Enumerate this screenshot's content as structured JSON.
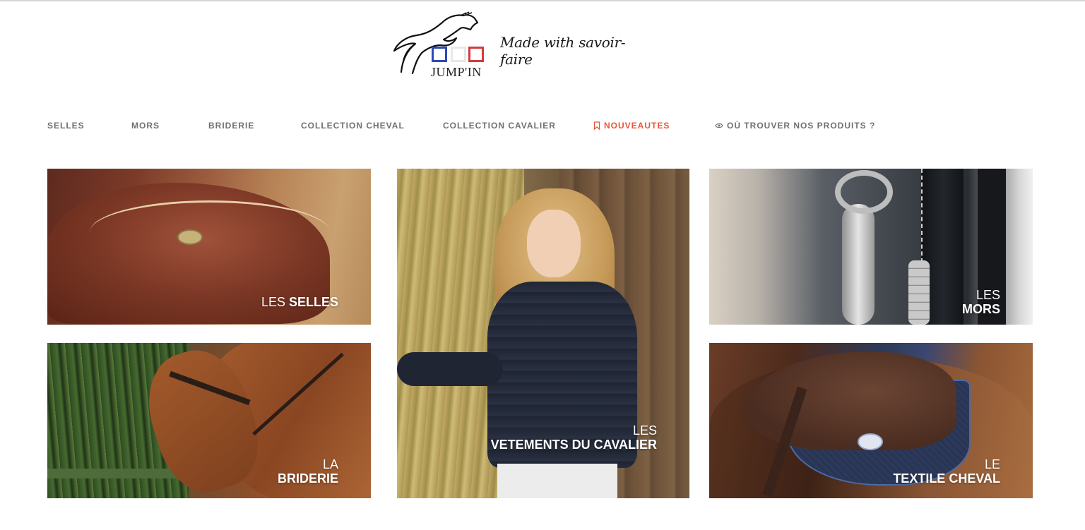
{
  "logo": {
    "brand": "JUMP'IN",
    "tagline": "Made with savoir-faire",
    "colors": {
      "blue": "#2f49b5",
      "white": "#e8e8e8",
      "red": "#d63a3a"
    }
  },
  "nav": {
    "items": [
      {
        "label": "SELLES"
      },
      {
        "label": "MORS"
      },
      {
        "label": "BRIDERIE"
      },
      {
        "label": "COLLECTION CHEVAL"
      },
      {
        "label": "COLLECTION CAVALIER"
      },
      {
        "label": "NOUVEAUTES",
        "icon": "bookmark-icon",
        "active": true
      },
      {
        "label": "OÙ TROUVER NOS PRODUITS ?",
        "icon": "eye-icon"
      }
    ],
    "active_color": "#e8553a"
  },
  "tiles": {
    "selles": {
      "line1": "LES",
      "line2": "SELLES"
    },
    "mors": {
      "line1": "LES",
      "line2": "MORS"
    },
    "briderie": {
      "line1": "LA",
      "line2": "BRIDERIE"
    },
    "vetements": {
      "line1": "LES",
      "line2": "VETEMENTS DU CAVALIER"
    },
    "textile": {
      "line1": "LE",
      "line2": "TEXTILE CHEVAL"
    }
  }
}
